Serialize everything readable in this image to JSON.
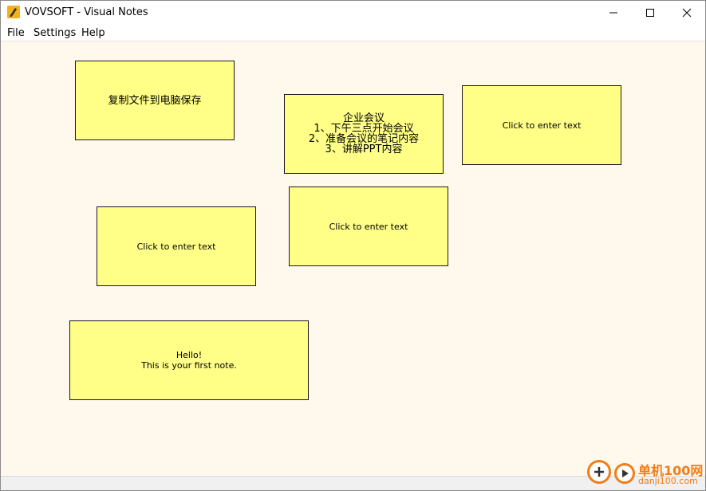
{
  "window": {
    "title": "VOVSOFT - Visual Notes",
    "minimize_icon": "minimize-icon",
    "maximize_icon": "maximize-icon",
    "close_icon": "close-icon"
  },
  "menu": {
    "items": [
      "File",
      "Settings",
      "Help"
    ]
  },
  "notes": [
    {
      "text": "复制文件到电脑保存",
      "lang": "cjk"
    },
    {
      "text": "企业会议\n1、下午三点开始会议\n2、准备会议的笔记内容\n3、讲解PPT内容",
      "lang": "cjk"
    },
    {
      "text": "Click to enter text",
      "lang": "latin"
    },
    {
      "text": "Click to enter text",
      "lang": "latin"
    },
    {
      "text": "Click to enter text",
      "lang": "latin"
    },
    {
      "text": "Hello!\nThis is your first note.",
      "lang": "latin"
    }
  ],
  "colors": {
    "note_background": "#ffff88",
    "canvas_background": "#fff8ed",
    "watermark": "#f07d1a"
  },
  "watermark": {
    "line1": "单机100网",
    "line2": "danji100.com"
  }
}
